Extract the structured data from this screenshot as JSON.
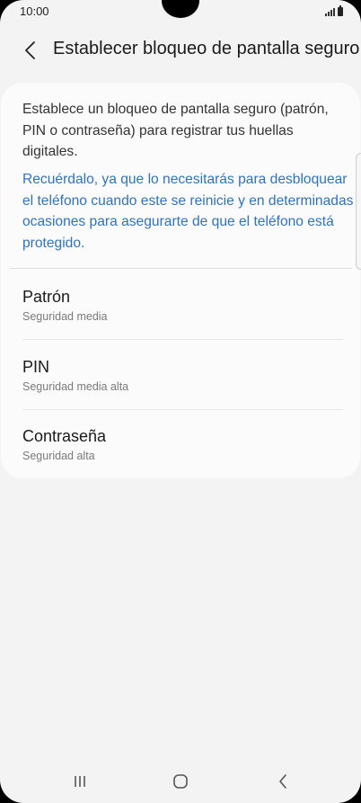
{
  "status_bar": {
    "time": "10:00",
    "icons": [
      "signal-icon",
      "battery-icon"
    ]
  },
  "header": {
    "back_icon": "chevron-left-icon",
    "title": "Establecer bloqueo de pantalla seguro"
  },
  "content": {
    "intro": "Establece un bloqueo de pantalla seguro (patrón, PIN o contraseña) para registrar tus huellas digitales.",
    "reminder": "Recuérdalo, ya que lo necesitarás para desbloquear el teléfono cuando este se reinicie y en determinadas ocasiones para asegurarte de que el teléfono está protegido.",
    "options": [
      {
        "title": "Patrón",
        "subtitle": "Seguridad media"
      },
      {
        "title": "PIN",
        "subtitle": "Seguridad media alta"
      },
      {
        "title": "Contraseña",
        "subtitle": "Seguridad alta"
      }
    ]
  },
  "nav_bar": {
    "icons": [
      "recents-icon",
      "home-icon",
      "back-icon"
    ]
  },
  "colors": {
    "background": "#f3f3f3",
    "card": "#fbfbfb",
    "accent_link": "#2f73b8",
    "text_primary": "#1a1a1a",
    "text_secondary": "#7a7a7a"
  }
}
